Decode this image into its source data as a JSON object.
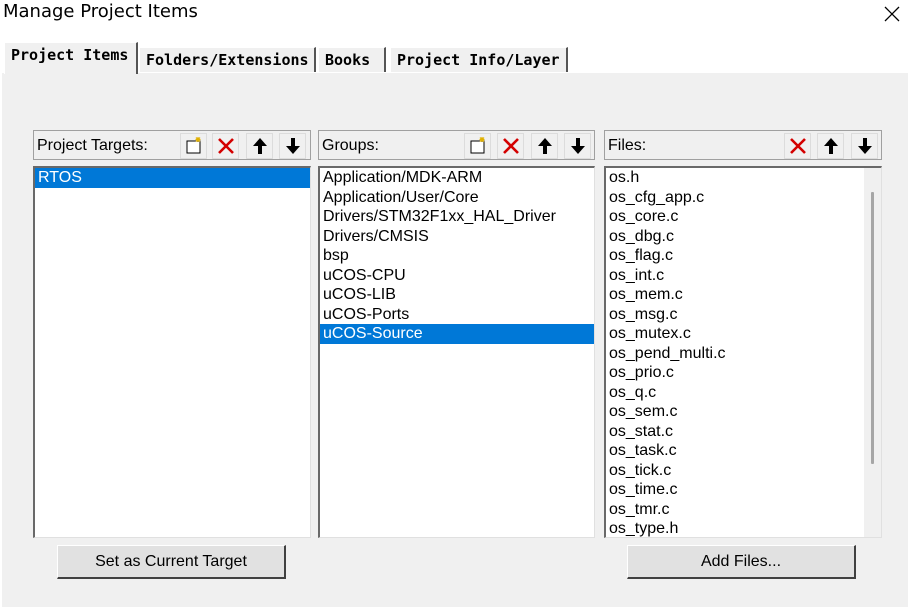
{
  "window": {
    "title": "Manage Project Items"
  },
  "tabs": [
    {
      "label": "Project Items",
      "active": true
    },
    {
      "label": "Folders/Extensions"
    },
    {
      "label": "Books"
    },
    {
      "label": "Project Info/Layer"
    }
  ],
  "targets": {
    "label": "Project Targets:",
    "items": [
      "RTOS"
    ],
    "selected": "RTOS"
  },
  "groups": {
    "label": "Groups:",
    "items": [
      "Application/MDK-ARM",
      "Application/User/Core",
      "Drivers/STM32F1xx_HAL_Driver",
      "Drivers/CMSIS",
      "bsp",
      "uCOS-CPU",
      "uCOS-LIB",
      "uCOS-Ports",
      "uCOS-Source"
    ],
    "selected": "uCOS-Source"
  },
  "files": {
    "label": "Files:",
    "items": [
      "os.h",
      "os_cfg_app.c",
      "os_core.c",
      "os_dbg.c",
      "os_flag.c",
      "os_int.c",
      "os_mem.c",
      "os_msg.c",
      "os_mutex.c",
      "os_pend_multi.c",
      "os_prio.c",
      "os_q.c",
      "os_sem.c",
      "os_stat.c",
      "os_task.c",
      "os_tick.c",
      "os_time.c",
      "os_tmr.c",
      "os_type.h"
    ]
  },
  "buttons": {
    "set_target": "Set as Current Target",
    "add_files": "Add Files..."
  },
  "colors": {
    "selection": "#0078d7",
    "delete_icon": "#d40000"
  }
}
